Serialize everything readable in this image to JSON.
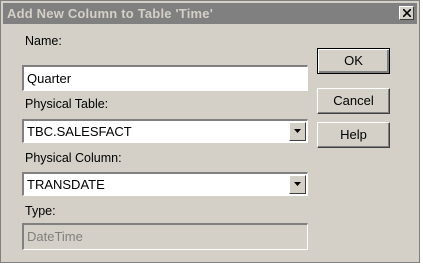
{
  "dialog": {
    "title": "Add New Column to Table 'Time'",
    "close_icon": "close-x-icon"
  },
  "form": {
    "name_label": "Name:",
    "name_value": "Quarter",
    "physical_table_label": "Physical Table:",
    "physical_table_value": "TBC.SALESFACT",
    "physical_column_label": "Physical Column:",
    "physical_column_value": "TRANSDATE",
    "type_label": "Type:",
    "type_value": "DateTime",
    "dropdown_icon": "chevron-down-icon"
  },
  "buttons": {
    "ok_label": "OK",
    "cancel_label": "Cancel",
    "help_label": "Help"
  },
  "colors": {
    "dialog_face": "#d4d0c8",
    "titlebar_inactive": "#808080",
    "disabled_text": "#808080"
  }
}
